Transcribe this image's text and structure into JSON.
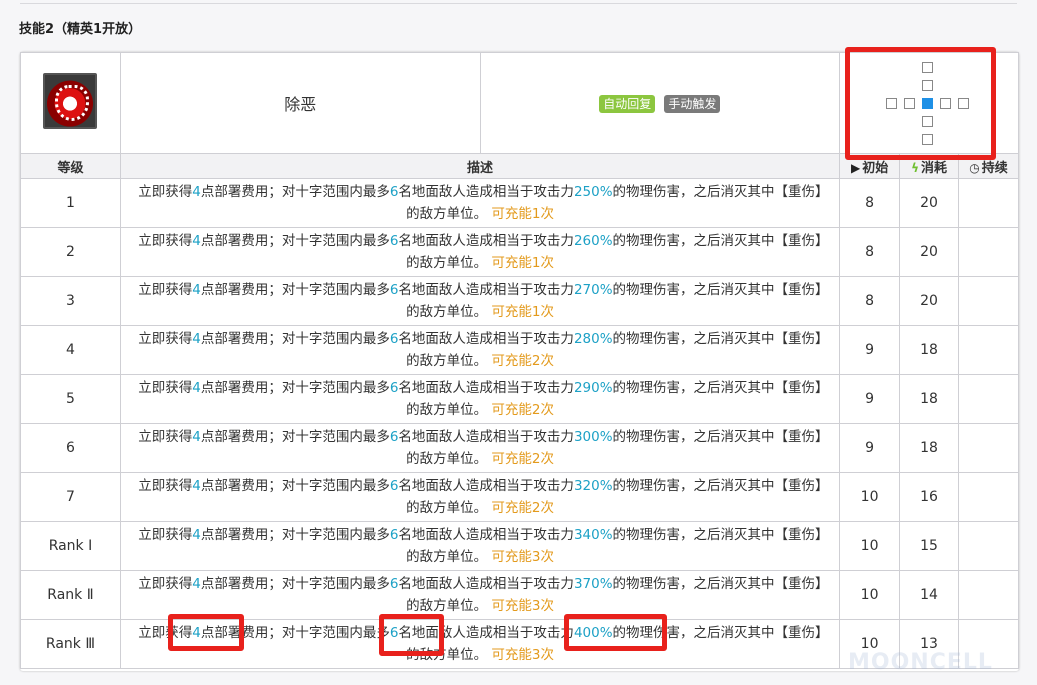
{
  "section_title": "技能2（精英1开放）",
  "skill": {
    "icon": "skill-icon",
    "name": "除恶",
    "tags": [
      {
        "label": "自动回复",
        "color": "#8cc63f"
      },
      {
        "label": "手动触发",
        "color": "#7a7a7a"
      }
    ],
    "range_pattern": "cross"
  },
  "columns": {
    "level": "等级",
    "description": "描述",
    "initial": "初始",
    "cost": "消耗",
    "duration": "持续",
    "initial_icon": "play-icon",
    "cost_icon": "lightning-icon",
    "duration_icon": "clock-icon"
  },
  "desc_parts": {
    "p1": "立即获得",
    "p2": "点部署费用；对十字范围内最多",
    "p3": "名地面敌人造成相当于攻击力",
    "p4": "的物理伤害，之后消灭其中【重伤】的敌方单位。",
    "charge_prefix": "可充能",
    "charge_suffix": "次"
  },
  "rows": [
    {
      "level": "1",
      "dp": "4",
      "targets": "6",
      "atk": "250%",
      "charges": "1",
      "initial": "8",
      "cost": "20",
      "duration": ""
    },
    {
      "level": "2",
      "dp": "4",
      "targets": "6",
      "atk": "260%",
      "charges": "1",
      "initial": "8",
      "cost": "20",
      "duration": ""
    },
    {
      "level": "3",
      "dp": "4",
      "targets": "6",
      "atk": "270%",
      "charges": "1",
      "initial": "8",
      "cost": "20",
      "duration": ""
    },
    {
      "level": "4",
      "dp": "4",
      "targets": "6",
      "atk": "280%",
      "charges": "2",
      "initial": "9",
      "cost": "18",
      "duration": ""
    },
    {
      "level": "5",
      "dp": "4",
      "targets": "6",
      "atk": "290%",
      "charges": "2",
      "initial": "9",
      "cost": "18",
      "duration": ""
    },
    {
      "level": "6",
      "dp": "4",
      "targets": "6",
      "atk": "300%",
      "charges": "2",
      "initial": "9",
      "cost": "18",
      "duration": ""
    },
    {
      "level": "7",
      "dp": "4",
      "targets": "6",
      "atk": "320%",
      "charges": "2",
      "initial": "10",
      "cost": "16",
      "duration": ""
    },
    {
      "level": "Rank Ⅰ",
      "dp": "4",
      "targets": "6",
      "atk": "340%",
      "charges": "3",
      "initial": "10",
      "cost": "15",
      "duration": ""
    },
    {
      "level": "Rank Ⅱ",
      "dp": "4",
      "targets": "6",
      "atk": "370%",
      "charges": "3",
      "initial": "10",
      "cost": "14",
      "duration": ""
    },
    {
      "level": "Rank Ⅲ",
      "dp": "4",
      "targets": "6",
      "atk": "400%",
      "charges": "3",
      "initial": "10",
      "cost": "13",
      "duration": ""
    }
  ],
  "watermark": "MOONCELL",
  "colors": {
    "highlight": "#1da1c6",
    "charge": "#e39a1c",
    "annotation": "#e8211c"
  }
}
